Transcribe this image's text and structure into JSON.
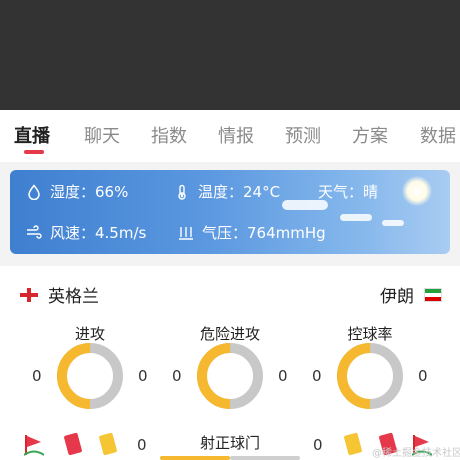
{
  "tabs": [
    {
      "label": "直播",
      "active": true
    },
    {
      "label": "聊天",
      "active": false
    },
    {
      "label": "指数",
      "active": false
    },
    {
      "label": "情报",
      "active": false
    },
    {
      "label": "预测",
      "active": false
    },
    {
      "label": "方案",
      "active": false
    },
    {
      "label": "数据",
      "active": false
    }
  ],
  "weather": {
    "humidity": "湿度：66%",
    "temperature": "温度：24°C",
    "condition": "天气：晴",
    "wind": "风速：4.5m/s",
    "pressure": "气压：764mmHg"
  },
  "match": {
    "home_team": "英格兰",
    "away_team": "伊朗",
    "stats": [
      {
        "title": "进攻",
        "home": "0",
        "away": "0",
        "home_share": 0.5
      },
      {
        "title": "危险进攻",
        "home": "0",
        "away": "0",
        "home_share": 0.5
      },
      {
        "title": "控球率",
        "home": "0",
        "away": "0",
        "home_share": 0.5
      }
    ],
    "shots_on_target": {
      "title": "射正球门",
      "home": "0",
      "away": "0",
      "home_share": 0.5
    }
  },
  "watermark": "@稀土掘金技术社区",
  "colors": {
    "accent": "#e5384a",
    "home_stat": "#f5b82e",
    "away_stat": "#c8c8c8"
  }
}
